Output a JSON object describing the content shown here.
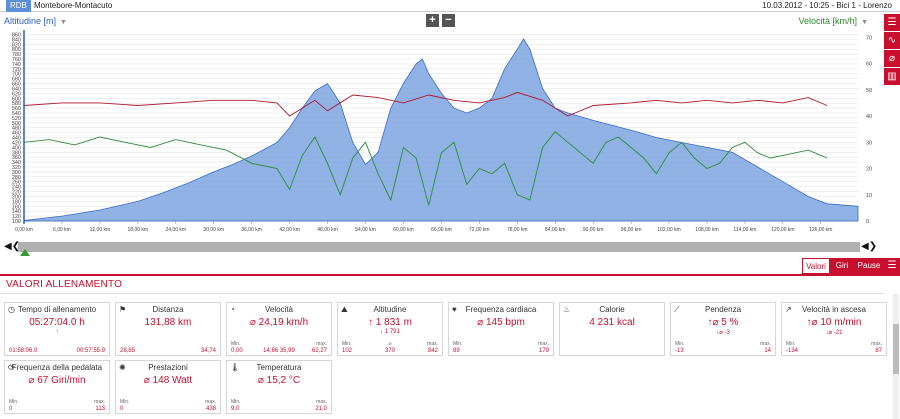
{
  "header": {
    "app": "RDB",
    "route": "Montebore-Montacuto",
    "meta": "10.03.2012  -  10:25  -  Bici 1  -  Lorenzo"
  },
  "axes": {
    "left_label": "Altitudine [m]",
    "right_label": "Velocità [km/h]",
    "zoom_in": "+",
    "zoom_out": "−"
  },
  "sidebar_icons": [
    "list-icon",
    "line-chart-icon",
    "diameter-icon",
    "bar-chart-icon"
  ],
  "chart_data": {
    "type": "area",
    "left_axis": {
      "label": "Altitudine [m]",
      "ticks": [
        100,
        120,
        140,
        160,
        180,
        200,
        220,
        240,
        260,
        280,
        300,
        320,
        340,
        360,
        380,
        400,
        420,
        440,
        460,
        480,
        500,
        520,
        540,
        560,
        580,
        600,
        620,
        640,
        660,
        680,
        700,
        720,
        740,
        760,
        780,
        800,
        820,
        840,
        860
      ],
      "ylim": [
        100,
        870
      ]
    },
    "right_axis": {
      "label": "Velocità [km/h]",
      "ticks": [
        0,
        10,
        20,
        30,
        40,
        50,
        60,
        70
      ],
      "ylim": [
        0,
        72
      ]
    },
    "x_ticks": [
      "0,00 km",
      "6,00 km",
      "12,00 km",
      "18,00 km",
      "24,00 km",
      "30,00 km",
      "36,00 km",
      "42,00 km",
      "48,00 km",
      "54,00 km",
      "60,00 km",
      "66,00 km",
      "72,00 km",
      "78,00 km",
      "84,00 km",
      "90,00 km",
      "96,00 km",
      "102,00 km",
      "108,00 km",
      "114,00 km",
      "120,00 km",
      "126,00 km"
    ],
    "altitude": {
      "x": [
        0,
        6,
        12,
        18,
        22,
        26,
        30,
        33,
        36,
        40,
        42,
        44,
        46,
        48,
        50,
        52,
        54,
        56,
        58,
        60,
        62,
        63,
        64,
        66,
        68,
        70,
        72,
        74,
        76,
        78,
        79,
        80,
        82,
        84,
        86,
        90,
        96,
        100,
        104,
        108,
        112,
        116,
        120,
        124,
        126,
        127,
        131.88
      ],
      "y": [
        102,
        120,
        145,
        180,
        215,
        255,
        300,
        330,
        365,
        420,
        480,
        560,
        630,
        660,
        580,
        420,
        330,
        380,
        560,
        660,
        740,
        760,
        700,
        620,
        560,
        540,
        560,
        600,
        720,
        800,
        842,
        800,
        640,
        560,
        540,
        510,
        470,
        440,
        420,
        400,
        380,
        320,
        260,
        200,
        180,
        170,
        160
      ]
    },
    "speed": {
      "x": [
        0,
        4,
        8,
        12,
        16,
        20,
        24,
        28,
        32,
        36,
        40,
        42,
        44,
        46,
        48,
        50,
        52,
        54,
        56,
        58,
        60,
        62,
        64,
        66,
        68,
        70,
        72,
        74,
        76,
        78,
        80,
        82,
        84,
        86,
        88,
        90,
        92,
        94,
        96,
        98,
        100,
        102,
        104,
        106,
        108,
        110,
        112,
        114,
        116,
        118,
        120,
        122,
        124,
        126,
        127
      ],
      "y": [
        30,
        31,
        29,
        32,
        30,
        28,
        31,
        29,
        27,
        22,
        20,
        12,
        25,
        32,
        22,
        10,
        24,
        30,
        18,
        8,
        28,
        24,
        6,
        26,
        30,
        14,
        20,
        18,
        22,
        10,
        8,
        28,
        34,
        30,
        26,
        22,
        30,
        32,
        28,
        24,
        18,
        26,
        30,
        24,
        20,
        22,
        28,
        30,
        26,
        24,
        25,
        26,
        27,
        25,
        24
      ]
    },
    "heart_rate": {
      "x": [
        0,
        6,
        12,
        18,
        24,
        30,
        36,
        40,
        42,
        46,
        48,
        52,
        56,
        60,
        64,
        68,
        72,
        76,
        78,
        82,
        86,
        90,
        96,
        100,
        104,
        108,
        112,
        116,
        120,
        124,
        127
      ],
      "y": [
        44,
        45,
        45,
        44,
        45,
        46,
        46,
        45,
        40,
        46,
        42,
        48,
        47,
        45,
        48,
        46,
        45,
        47,
        49,
        46,
        40,
        44,
        45,
        46,
        45,
        46,
        45,
        46,
        45,
        47,
        44
      ]
    }
  },
  "tabs": {
    "valori": "Valori",
    "giri": "Giri",
    "pausa": "Pause",
    "list_icon": "list-icon"
  },
  "section_title": "VALORI ALLENAMENTO",
  "cards": [
    {
      "icon": "clock-icon",
      "title": "Tempo di allenamento",
      "main": "05:27:04.0 h",
      "subs": [
        "↑",
        ""
      ],
      "labels": [],
      "left": "01:58:06.0",
      "right": "00:57:55.9",
      "mid": ""
    },
    {
      "icon": "distance-icon",
      "title": "Distanza",
      "main": "131,88 km",
      "subs": [],
      "labels": [],
      "left": "28,85",
      "right": "34,74",
      "mid": ""
    },
    {
      "icon": "speed-icon",
      "title": "Velocità",
      "main": "⌀ 24,19 km/h",
      "subs": [],
      "labels": [
        "Min.",
        "max."
      ],
      "left": "0,00",
      "mid": "14,66  35,99",
      "right": "62,27"
    },
    {
      "icon": "altitude-icon",
      "title": "Altitudine",
      "main": "↑ 1 831 m",
      "subs": [
        "↓ 1 791"
      ],
      "labels": [
        "Min.",
        "⌀",
        "max."
      ],
      "left": "102",
      "mid": "370",
      "right": "842"
    },
    {
      "icon": "heart-icon",
      "title": "Frequenza cardiaca",
      "main": "⌀ 145 bpm",
      "subs": [],
      "labels": [
        "Min.",
        "max."
      ],
      "left": "89",
      "mid": "",
      "right": "179"
    },
    {
      "icon": "calorie-icon",
      "title": "Calorie",
      "main": "4 231 kcal",
      "subs": [],
      "labels": [],
      "left": "",
      "mid": "",
      "right": ""
    },
    {
      "icon": "slope-icon",
      "title": "Pendenza",
      "main": "↑⌀ 5 %",
      "subs": [
        "↓⌀ -3"
      ],
      "labels": [
        "Min.",
        "max."
      ],
      "left": "-13",
      "mid": "",
      "right": "14"
    },
    {
      "icon": "climb-speed-icon",
      "title": "Velocità in ascesa",
      "main": "↑⌀ 10 m/min",
      "subs": [
        "↓⌀ -21"
      ],
      "labels": [
        "Min.",
        "max."
      ],
      "left": "-134",
      "mid": "",
      "right": "87"
    },
    {
      "icon": "cadence-icon",
      "title": "Frequenza della pedalata",
      "main": "⌀ 67 Giri/min",
      "subs": [],
      "labels": [
        "Min.",
        "max."
      ],
      "left": "0",
      "mid": "",
      "right": "113"
    },
    {
      "icon": "power-icon",
      "title": "Prestazioni",
      "main": "⌀ 148 Watt",
      "subs": [],
      "labels": [
        "Min.",
        "max."
      ],
      "left": "0",
      "mid": "",
      "right": "438"
    },
    {
      "icon": "temperature-icon",
      "title": "Temperatura",
      "main": "⌀ 15,2 °C",
      "subs": [],
      "labels": [
        "Min.",
        "max."
      ],
      "left": "9,0",
      "mid": "",
      "right": "21,0"
    }
  ]
}
